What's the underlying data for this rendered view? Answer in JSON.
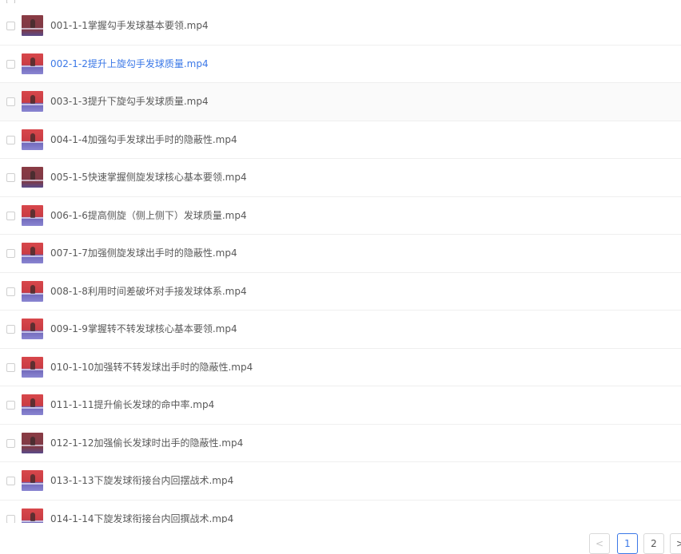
{
  "files": [
    {
      "name": "001-1-1掌握勾手发球基本要领.mp4",
      "active": false
    },
    {
      "name": "002-1-2提升上旋勾手发球质量.mp4",
      "active": true
    },
    {
      "name": "003-1-3提升下旋勾手发球质量.mp4",
      "active": false
    },
    {
      "name": "004-1-4加强勾手发球出手时的隐蔽性.mp4",
      "active": false
    },
    {
      "name": "005-1-5快速掌握侧旋发球核心基本要领.mp4",
      "active": false
    },
    {
      "name": "006-1-6提高侧旋（侧上侧下）发球质量.mp4",
      "active": false
    },
    {
      "name": "007-1-7加强侧旋发球出手时的隐蔽性.mp4",
      "active": false
    },
    {
      "name": "008-1-8利用时间差破坏对手接发球体系.mp4",
      "active": false
    },
    {
      "name": "009-1-9掌握转不转发球核心基本要领.mp4",
      "active": false
    },
    {
      "name": "010-1-10加强转不转发球出手时的隐蔽性.mp4",
      "active": false
    },
    {
      "name": "011-1-11提升偷长发球的命中率.mp4",
      "active": false
    },
    {
      "name": "012-1-12加强偷长发球时出手的隐蔽性.mp4",
      "active": false
    },
    {
      "name": "013-1-13下旋发球衔接台内回摆战术.mp4",
      "active": false
    },
    {
      "name": "014-1-14下旋发球衔接台内回撰战术.mp4",
      "active": false
    }
  ],
  "pagination": {
    "prev_label": "<",
    "pages": [
      "1",
      "2"
    ],
    "current": "1",
    "next_label": ">"
  },
  "colors": {
    "accent": "#3b78e7",
    "text": "#595959",
    "thumbnail_red": "#d8474b",
    "thumbnail_blue": "#6f66b8"
  },
  "icons": {
    "checkbox": "checkbox-icon",
    "thumbnail": "video-thumbnail"
  }
}
